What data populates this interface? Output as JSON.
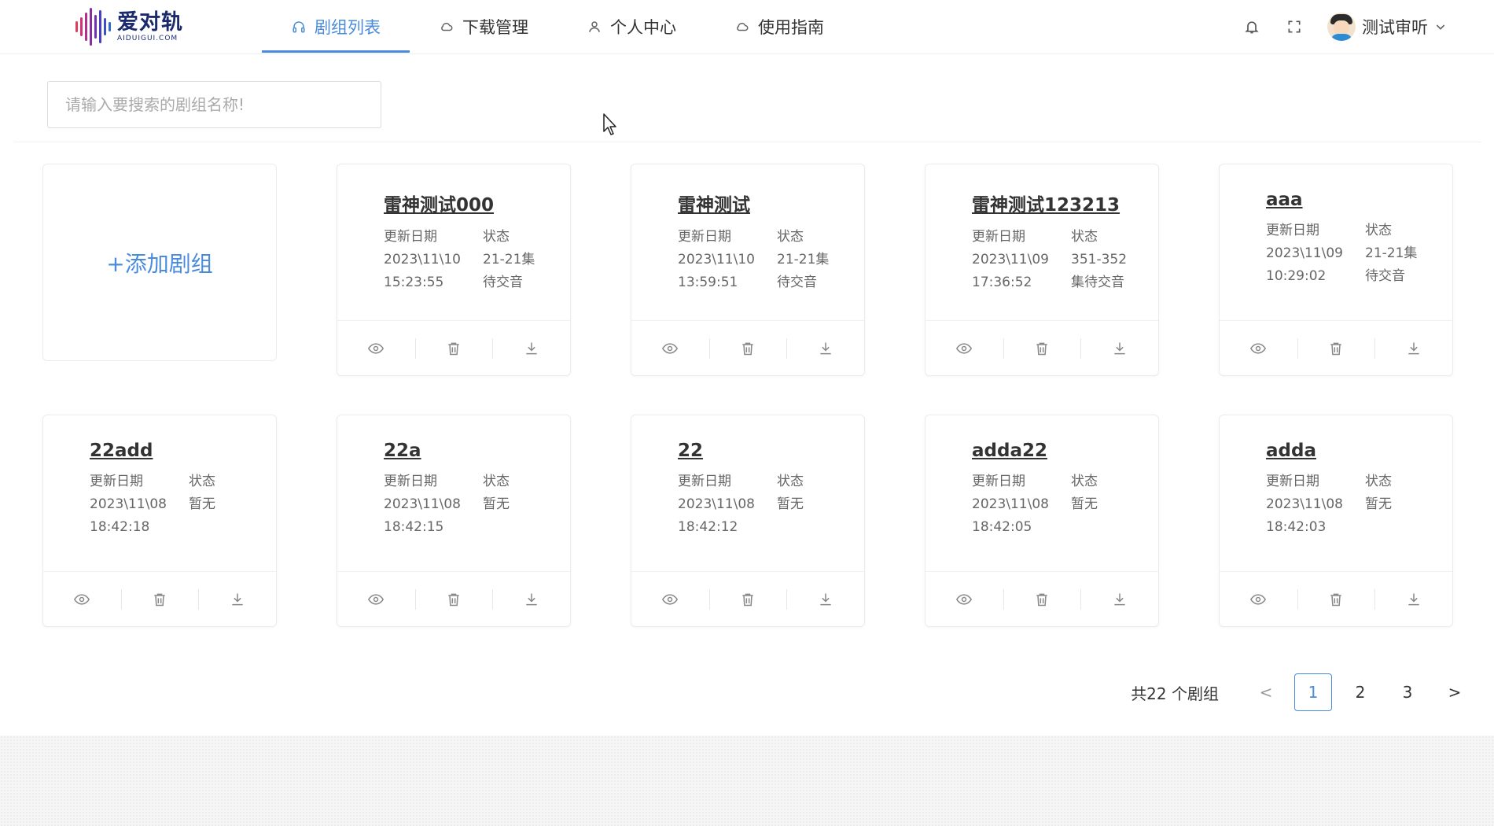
{
  "logo": {
    "name": "爱对轨",
    "domain": "AIDUIGUI.COM"
  },
  "nav": [
    {
      "label": "剧组列表",
      "icon": "headphones-icon",
      "active": true
    },
    {
      "label": "下载管理",
      "icon": "cloud-icon",
      "active": false
    },
    {
      "label": "个人中心",
      "icon": "user-icon",
      "active": false
    },
    {
      "label": "使用指南",
      "icon": "cloud-icon",
      "active": false
    }
  ],
  "header": {
    "user_name": "测试审听"
  },
  "search": {
    "placeholder": "请输入要搜索的剧组名称!",
    "value": ""
  },
  "add_button": {
    "label": "+添加剧组"
  },
  "card_labels": {
    "date": "更新日期",
    "status": "状态"
  },
  "cards": [
    {
      "title": "雷神测试000",
      "date": "2023\\11\\10",
      "time": "15:23:55",
      "status1": "21-21集",
      "status2": "待交音"
    },
    {
      "title": "雷神测试",
      "date": "2023\\11\\10",
      "time": "13:59:51",
      "status1": "21-21集",
      "status2": "待交音"
    },
    {
      "title": "雷神测试123213",
      "date": "2023\\11\\09",
      "time": "17:36:52",
      "status1": "351-352",
      "status2": "集待交音"
    },
    {
      "title": "aaa",
      "date": "2023\\11\\09",
      "time": "10:29:02",
      "status1": "21-21集",
      "status2": "待交音"
    },
    {
      "title": "22add",
      "date": "2023\\11\\08",
      "time": "18:42:18",
      "status1": "暂无",
      "status2": ""
    },
    {
      "title": "22a",
      "date": "2023\\11\\08",
      "time": "18:42:15",
      "status1": "暂无",
      "status2": ""
    },
    {
      "title": "22",
      "date": "2023\\11\\08",
      "time": "18:42:12",
      "status1": "暂无",
      "status2": ""
    },
    {
      "title": "adda22",
      "date": "2023\\11\\08",
      "time": "18:42:05",
      "status1": "暂无",
      "status2": ""
    },
    {
      "title": "adda",
      "date": "2023\\11\\08",
      "time": "18:42:03",
      "status1": "暂无",
      "status2": ""
    }
  ],
  "pagination": {
    "total": "共22 个剧组",
    "pages": [
      "1",
      "2",
      "3"
    ],
    "current": "1",
    "prev": "<",
    "next": ">"
  },
  "colors": {
    "accent": "#4a8cdb",
    "text": "#333333",
    "muted": "#666666"
  }
}
